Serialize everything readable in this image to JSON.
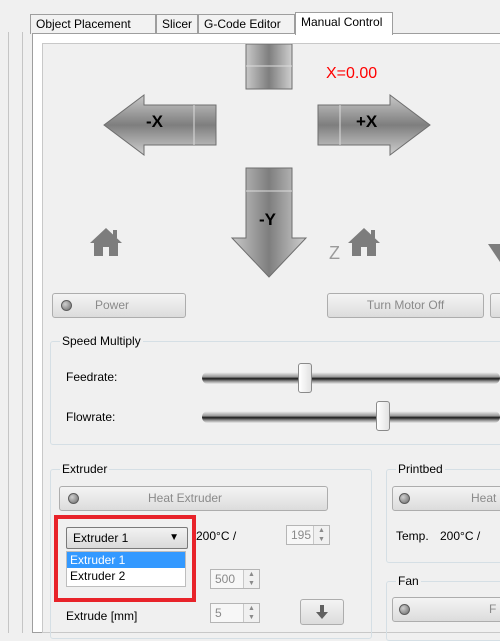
{
  "tabs": [
    {
      "label": "Object Placement"
    },
    {
      "label": "Slicer"
    },
    {
      "label": "G-Code Editor"
    },
    {
      "label": "Manual Control"
    }
  ],
  "jog": {
    "x_readout": "X=0.00",
    "minus_x": "-X",
    "plus_x": "+X",
    "minus_y": "-Y",
    "z_label": "Z",
    "home_icon": "home-icon"
  },
  "buttons": {
    "power": "Power",
    "turn_motor_off": "Turn Motor Off"
  },
  "speed": {
    "title": "Speed Multiply",
    "feedrate_label": "Feedrate:",
    "flowrate_label": "Flowrate:"
  },
  "extruder": {
    "title": "Extruder",
    "heat_button": "Heat Extruder",
    "selected": "Extruder 1",
    "options": [
      "Extruder 1",
      "Extruder 2"
    ],
    "temp_readout": "200°C /",
    "target_temp": "195",
    "speed_value": "500",
    "extrude_label": "Extrude [mm]",
    "extrude_value": "5"
  },
  "printbed": {
    "title": "Printbed",
    "heat_button": "Heat",
    "temp_label": "Temp.",
    "temp_readout": "200°C /"
  },
  "fan": {
    "title": "Fan",
    "button": "F"
  },
  "colors": {
    "x_readout": "#ff0000",
    "highlight": "#e8232a",
    "selection": "#3399ff"
  }
}
